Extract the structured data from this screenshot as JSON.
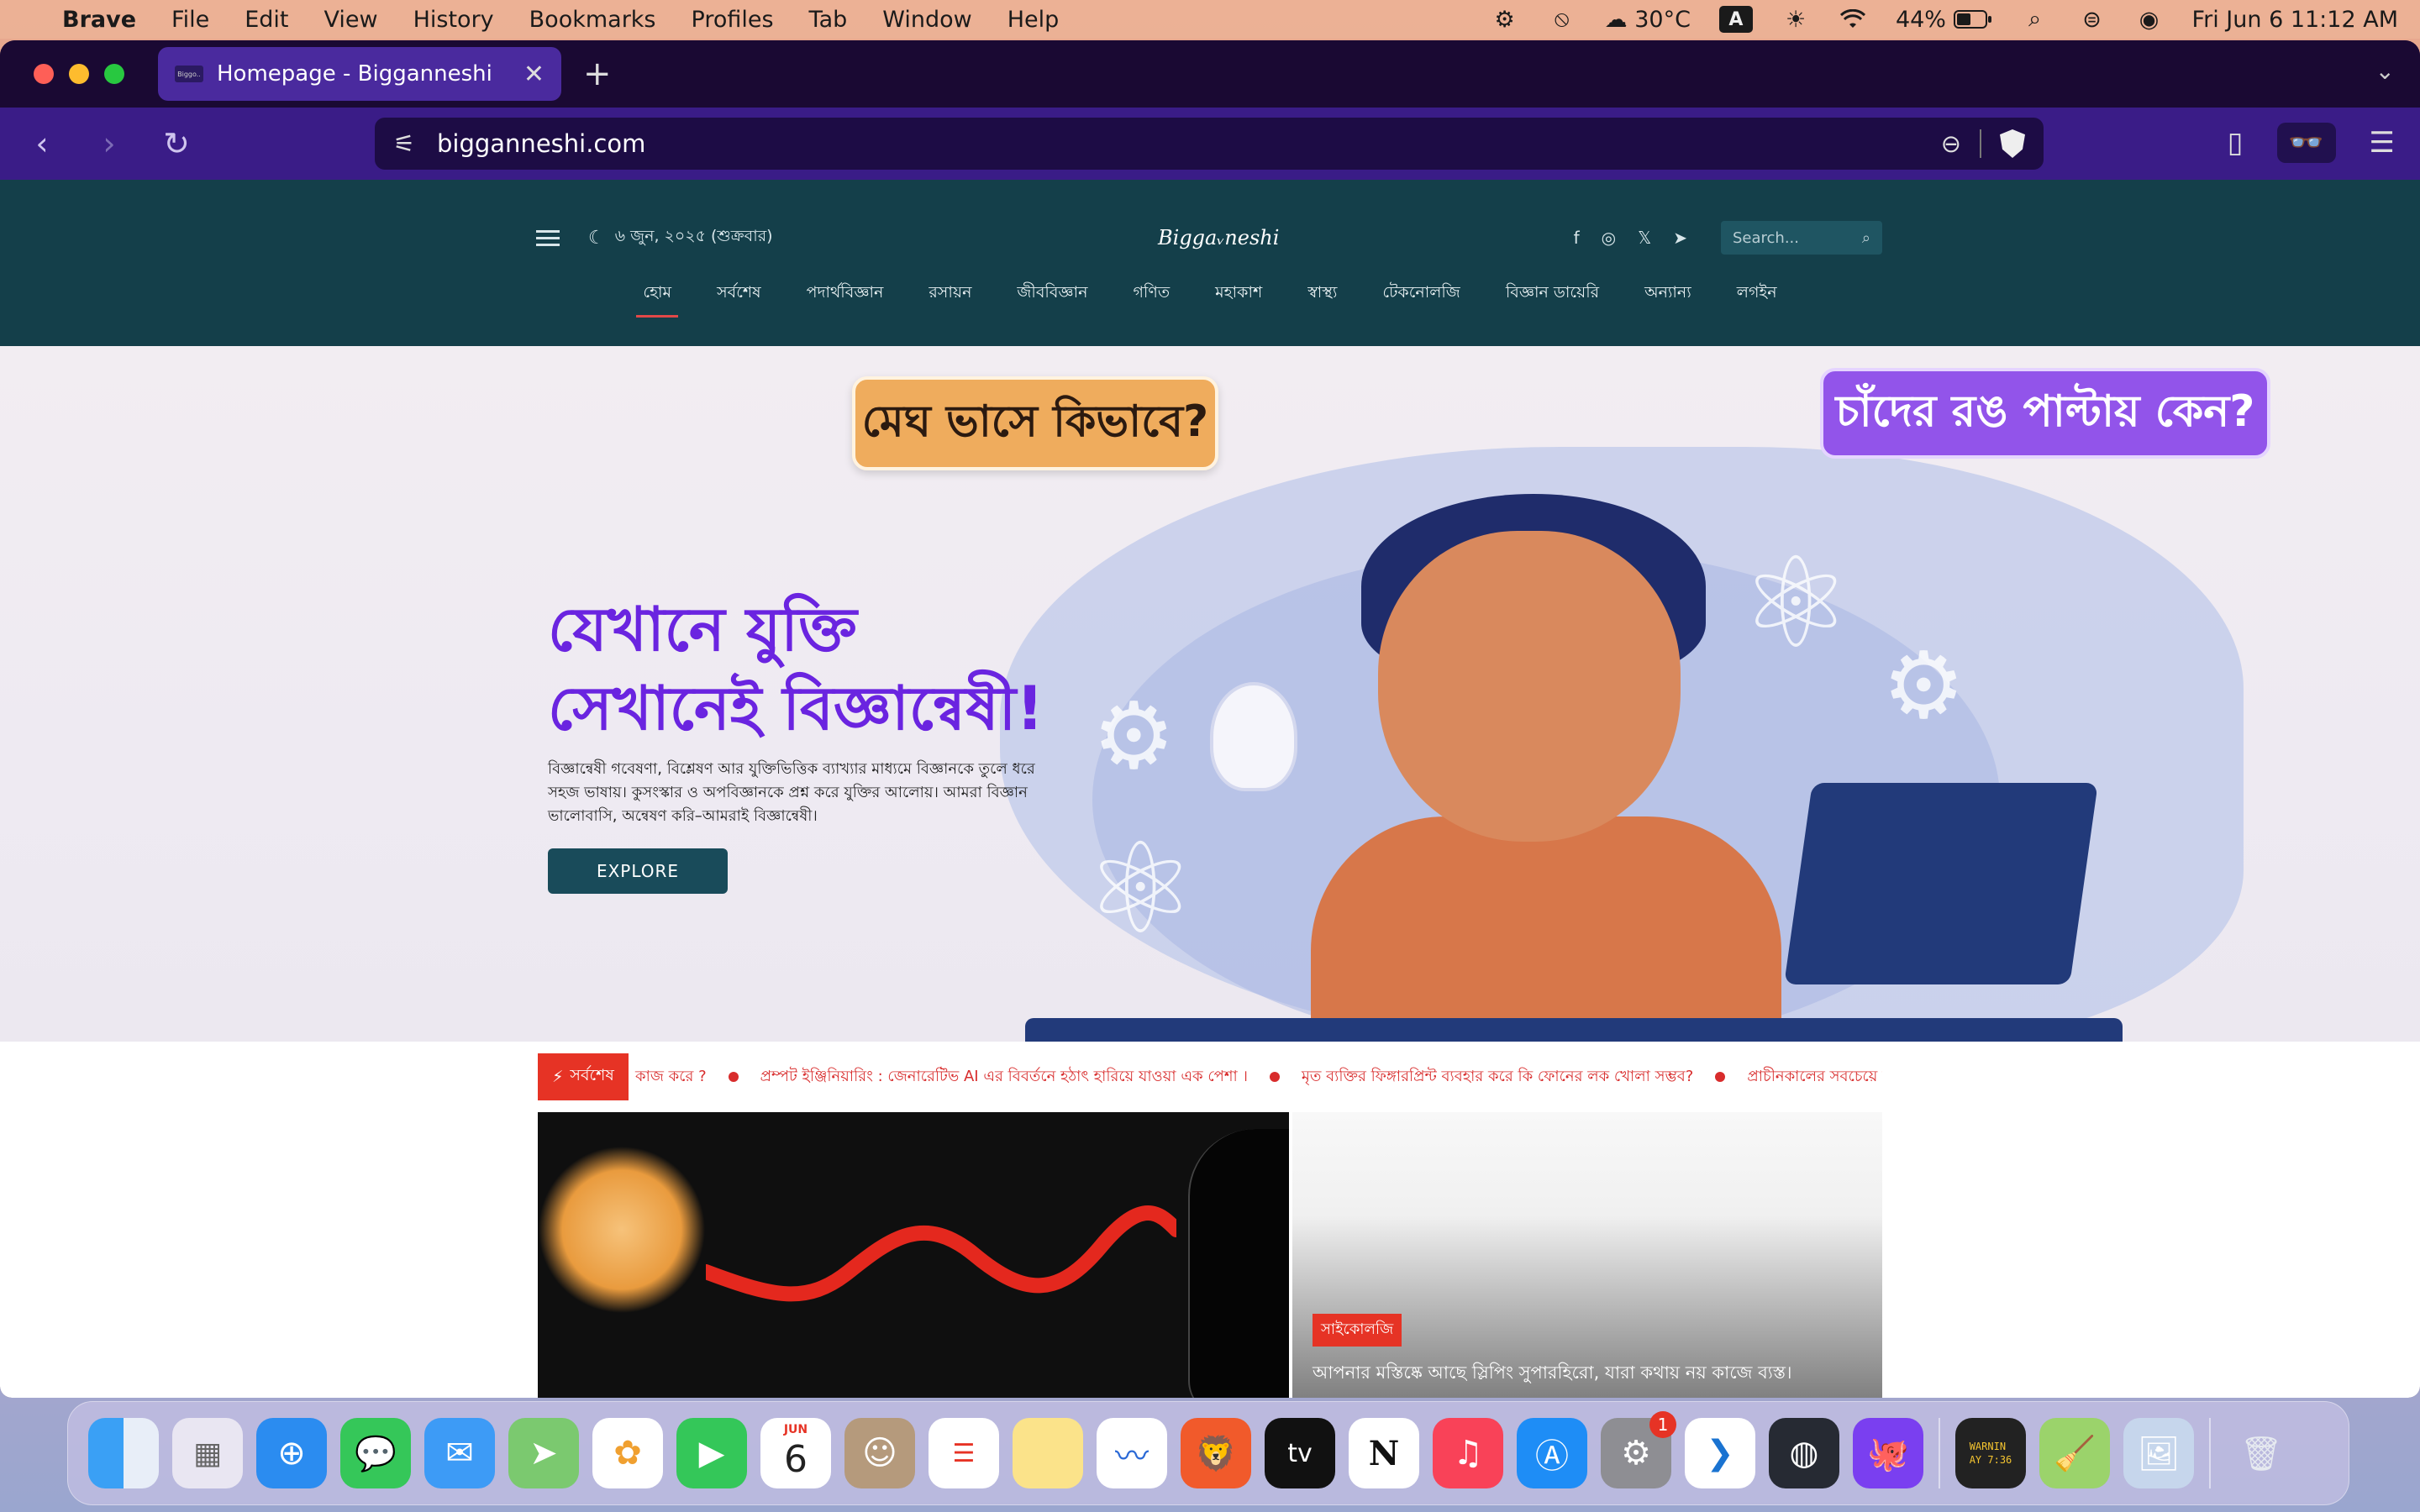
{
  "menubar": {
    "app": "Brave",
    "menus": [
      "File",
      "Edit",
      "View",
      "History",
      "Bookmarks",
      "Profiles",
      "Tab",
      "Window",
      "Help"
    ],
    "weather": "30°C",
    "input_source": "A",
    "battery": "44%",
    "datetime": "Fri Jun 6  11:12 AM"
  },
  "browser": {
    "tab_title": "Homepage - Bigganneshi",
    "favicon_text": "Biggo..",
    "url": "bigganneshi.com"
  },
  "site": {
    "date": "৬ জুন, ২০২৫ (শুক্রবার)",
    "logo": "Biggaᵥneshi",
    "search_placeholder": "Search...",
    "nav": [
      "হোম",
      "সর্বশেষ",
      "পদার্থবিজ্ঞান",
      "রসায়ন",
      "জীববিজ্ঞান",
      "গণিত",
      "মহাকাশ",
      "স্বাস্থ্য",
      "টেকনোলজি",
      "বিজ্ঞান ডায়েরি",
      "অন্যান্য",
      "লগইন"
    ],
    "hero": {
      "bubble1": "মেঘ ভাসে কিভাবে?",
      "bubble2": "চাঁদের রঙ পাল্টায় কেন?",
      "title_line1": "যেখানে যুক্তি",
      "title_line2": "সেখানেই বিজ্ঞান্বেষী!",
      "description": "বিজ্ঞান্বেষী গবেষণা, বিশ্লেষণ আর যুক্তিভিত্তিক ব্যাখ্যার মাধ্যমে বিজ্ঞানকে তুলে ধরে সহজ ভাষায়। কুসংস্কার ও অপবিজ্ঞানকে প্রশ্ন করে যুক্তির আলোয়। আমরা বিজ্ঞান ভালোবাসি, অন্বেষণ করি–আমরাই বিজ্ঞান্বেষী।",
      "cta": "EXPLORE"
    },
    "ticker": {
      "label": "সর্বশেষ",
      "items": [
        "কাজ করে ?",
        "প্রম্পট ইঞ্জিনিয়ারিং : জেনারেটিভ AI এর বিবর্তনে হঠাৎ হারিয়ে যাওয়া এক পেশা ।",
        "মৃত ব্যক্তির ফিঙ্গারপ্রিন্ট ব্যবহার করে কি ফোনের লক খোলা সম্ভব?",
        "প্রাচীনকালের সবচেয়ে ভয়ানক শাস্তি"
      ]
    },
    "feature_side": {
      "tag": "সাইকোলজি",
      "title": "আপনার মস্তিষ্কে আছে স্লিপিং সুপারহিরো, যারা কথায় নয় কাজে ব্যস্ত।"
    }
  },
  "dock": {
    "calendar_month": "JUN",
    "calendar_day": "6",
    "settings_badge": "1",
    "console_text": "WARNIN\nAY 7:36",
    "apps": [
      "finder",
      "launchpad",
      "safari",
      "messages",
      "mail",
      "maps",
      "photos",
      "facetime",
      "calendar",
      "contacts",
      "reminders",
      "notes",
      "freeform",
      "brave",
      "tv",
      "notion",
      "music",
      "app-store",
      "system-settings",
      "vscode",
      "obs",
      "github-desktop",
      "console",
      "cleaner",
      "preview",
      "trash"
    ]
  }
}
